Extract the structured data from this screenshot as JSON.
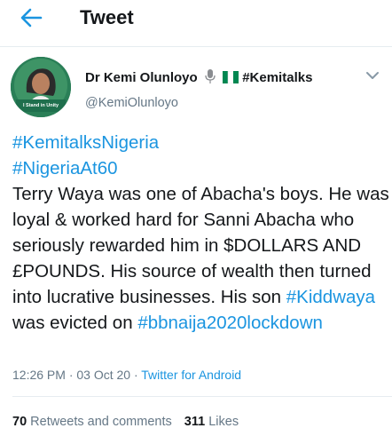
{
  "header": {
    "title": "Tweet",
    "back_icon": "arrow-left-icon"
  },
  "author": {
    "name": "Dr Kemi Olunloyo",
    "name_suffix": "#Kemitalks",
    "handle": "@KemiOlunloyo",
    "avatar_badge": "I Stand in Unity"
  },
  "tweet": {
    "line1_tag": "#KemitalksNigeria",
    "line2_tag": "#NigeriaAt60",
    "text_before_tag1": "Terry Waya was one of Abacha's boys. He was loyal & worked hard for Sanni Abacha who seriously rewarded him in $DOLLARS AND £POUNDS. His source of wealth then turned into lucrative businesses. His son ",
    "inline_tag1": "#Kiddwaya",
    "text_between": " was evicted on ",
    "inline_tag2": "#bbnaija2020lockdown"
  },
  "meta": {
    "time": "12:26 PM · 03 Oct 20 · ",
    "source": "Twitter for Android"
  },
  "stats": {
    "retweets_count": "70",
    "retweets_label": " Retweets and comments",
    "likes_count": "311",
    "likes_label": " Likes"
  },
  "colors": {
    "link": "#1b95e0",
    "secondary": "#657786",
    "divider": "#e6ecf0"
  }
}
